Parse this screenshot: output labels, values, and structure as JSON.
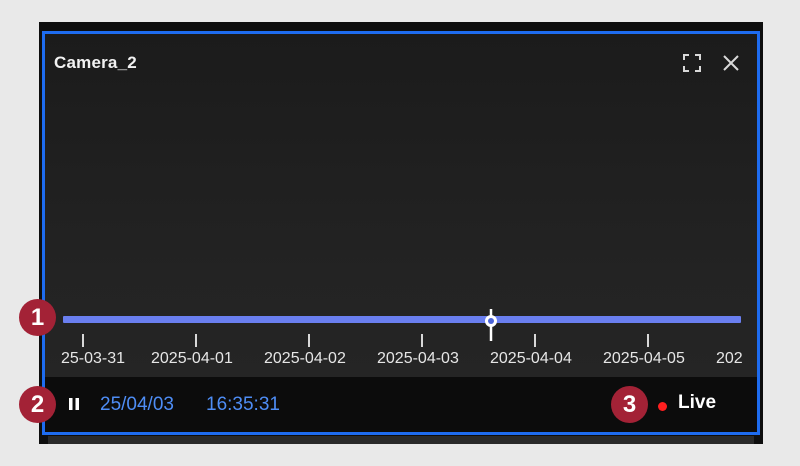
{
  "camera": {
    "title": "Camera_2"
  },
  "window_controls": {
    "fullscreen_icon": "fullscreen-icon",
    "close_icon": "close-icon"
  },
  "timeline": {
    "tick_labels": [
      "25-03-31",
      "2025-04-01",
      "2025-04-02",
      "2025-04-03",
      "2025-04-04",
      "2025-04-05",
      "202"
    ],
    "track_color": "#6a7ff0"
  },
  "controls": {
    "pause_icon": "pause-icon",
    "date": "25/04/03",
    "time": "16:35:31",
    "live_label": "Live",
    "live_dot_color": "#ff1f1f",
    "accent_color": "#4e8df5"
  },
  "callouts": [
    "1",
    "2",
    "3"
  ],
  "colors": {
    "border": "#1e6cf0",
    "callout_bg": "#a32236"
  }
}
